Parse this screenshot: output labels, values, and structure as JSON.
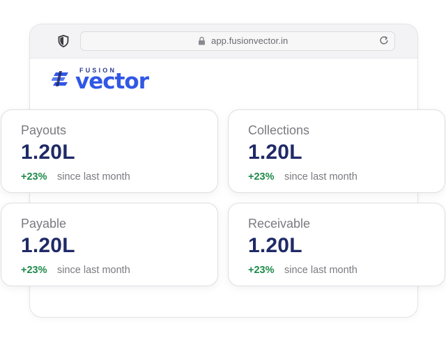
{
  "browser": {
    "url": "app.fusionvector.in"
  },
  "logo": {
    "top_text": "FUSION",
    "main_text": "vector"
  },
  "cards": [
    {
      "label": "Payouts",
      "value": "1.20L",
      "change": "+23%",
      "since": "since last month"
    },
    {
      "label": "Collections",
      "value": "1.20L",
      "change": "+23%",
      "since": "since last month"
    },
    {
      "label": "Payable",
      "value": "1.20L",
      "change": "+23%",
      "since": "since last month"
    },
    {
      "label": "Receivable",
      "value": "1.20L",
      "change": "+23%",
      "since": "since last month"
    }
  ],
  "colors": {
    "value": "#1f2a66",
    "positive": "#1e8a4a",
    "brand": "#3157e6"
  }
}
